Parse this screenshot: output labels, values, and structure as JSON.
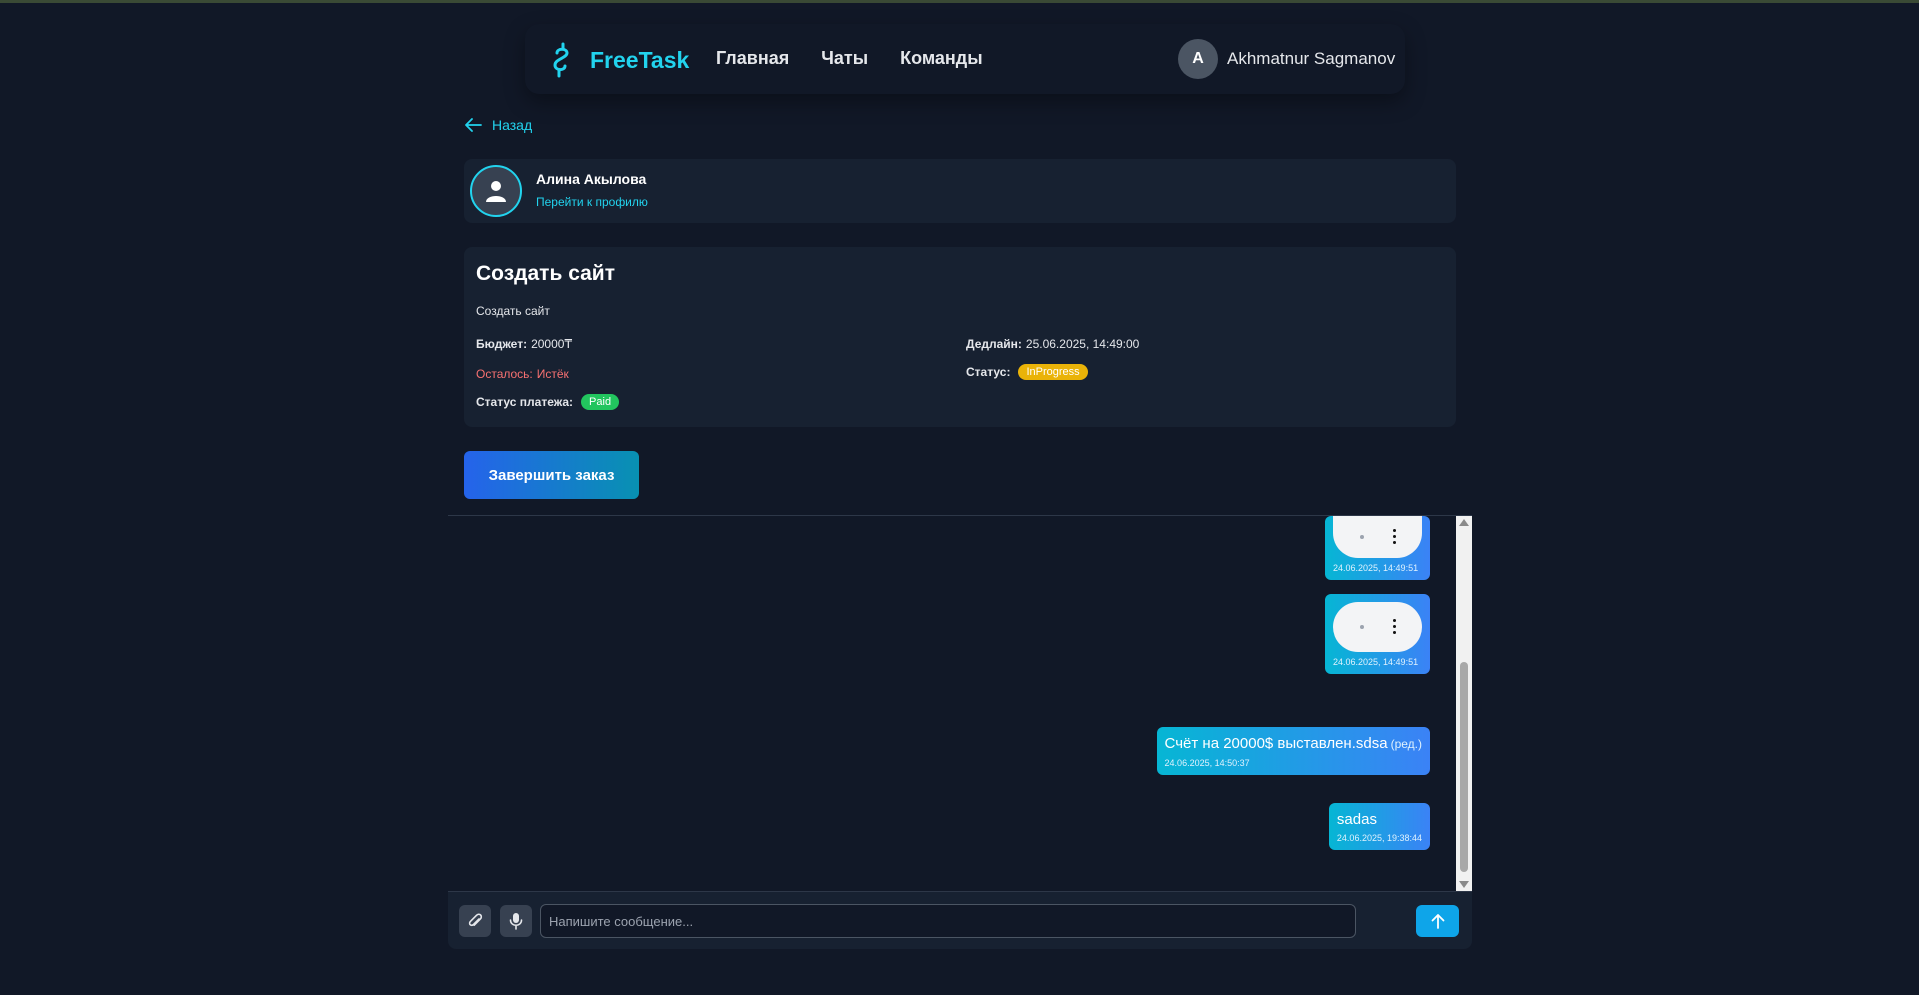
{
  "app": {
    "name": "FreeTask"
  },
  "nav": {
    "links": [
      {
        "label": "Главная"
      },
      {
        "label": "Чаты"
      },
      {
        "label": "Команды"
      }
    ],
    "user": {
      "initial": "A",
      "name": "Akhmatnur Sagmanov"
    }
  },
  "back": {
    "label": "Назад"
  },
  "profile": {
    "name": "Алина Акылова",
    "link": "Перейти к профилю"
  },
  "order": {
    "title": "Создать сайт",
    "description": "Создать сайт",
    "budget_label": "Бюджет:",
    "budget_value": "20000₸",
    "remaining_label": "Осталось:",
    "remaining_value": "Истёк",
    "payment_label": "Статус платежа:",
    "payment_value": "Paid",
    "deadline_label": "Дедлайн:",
    "deadline_value": "25.06.2025, 14:49:00",
    "status_label": "Статус:",
    "status_value": "InProgress"
  },
  "finish_button": {
    "label": "Завершить заказ"
  },
  "messages": [
    {
      "type": "audio",
      "time": "24.06.2025, 14:49:51"
    },
    {
      "type": "audio",
      "time": "24.06.2025, 14:49:51"
    },
    {
      "type": "text",
      "text": "Счёт на 20000$ выставлен.sdsa",
      "edited": "(ред.)",
      "time": "24.06.2025, 14:50:37"
    },
    {
      "type": "text",
      "text": "sadas",
      "time": "24.06.2025, 19:38:44"
    }
  ],
  "composer": {
    "placeholder": "Напишите сообщение..."
  },
  "colors": {
    "background": "#111827",
    "card": "#172131",
    "accent": "#22d3ee",
    "danger": "#f87171",
    "status_in_progress": "#eab308",
    "status_paid": "#22c55e",
    "primary_button": "#2563eb",
    "send_button": "#0ea5e9"
  },
  "icons": {
    "logo": "dollar-snake-icon",
    "back": "arrow-left-icon",
    "profile_avatar": "user-icon",
    "attach": "paperclip-icon",
    "mic": "microphone-icon",
    "send": "arrow-up-icon",
    "audio_menu": "kebab-menu-icon"
  }
}
